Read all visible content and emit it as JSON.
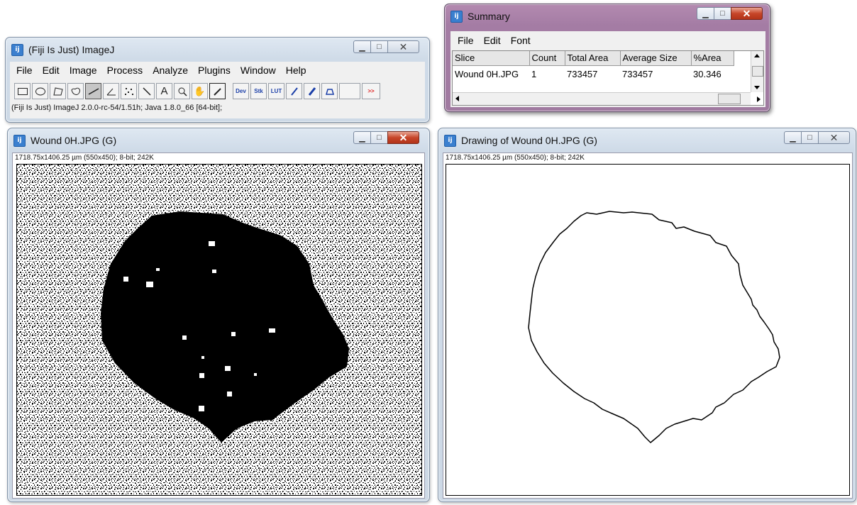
{
  "imagej": {
    "title": "(Fiji Is Just) ImageJ",
    "menu": [
      "File",
      "Edit",
      "Image",
      "Process",
      "Analyze",
      "Plugins",
      "Window",
      "Help"
    ],
    "tools": [
      "rectangle",
      "oval",
      "polygon",
      "freehand",
      "line",
      "angle",
      "multipoint",
      "wand",
      "text",
      "magnifier",
      "hand",
      "dropper",
      "Dev",
      "Stk",
      "LUT",
      "pencil",
      "brush",
      "flood-fill",
      "spacer",
      ">>"
    ],
    "tool_labels": {
      "dev": "Dev",
      "stk": "Stk",
      "lut": "LUT",
      "more": ">>"
    },
    "status": "(Fiji Is Just) ImageJ 2.0.0-rc-54/1.51h; Java 1.8.0_66 [64-bit];"
  },
  "summary": {
    "title": "Summary",
    "menu": [
      "File",
      "Edit",
      "Font"
    ],
    "columns": [
      "Slice",
      "Count",
      "Total Area",
      "Average Size",
      "%Area"
    ],
    "rows": [
      [
        "Wound 0H.JPG",
        "1",
        "733457",
        "733457",
        "30.346"
      ]
    ]
  },
  "wound": {
    "title": "Wound 0H.JPG (G)",
    "info": "1718.75x1406.25 µm (550x450); 8-bit; 242K"
  },
  "drawing": {
    "title": "Drawing of Wound 0H.JPG (G)",
    "info": "1718.75x1406.25 µm (550x450); 8-bit; 242K"
  },
  "icons": {
    "minimize": "minimize-icon",
    "maximize": "maximize-icon",
    "close": "close-icon"
  },
  "colors": {
    "close_active": "#c7462a",
    "fiji_blue": "#3a7fcf"
  }
}
